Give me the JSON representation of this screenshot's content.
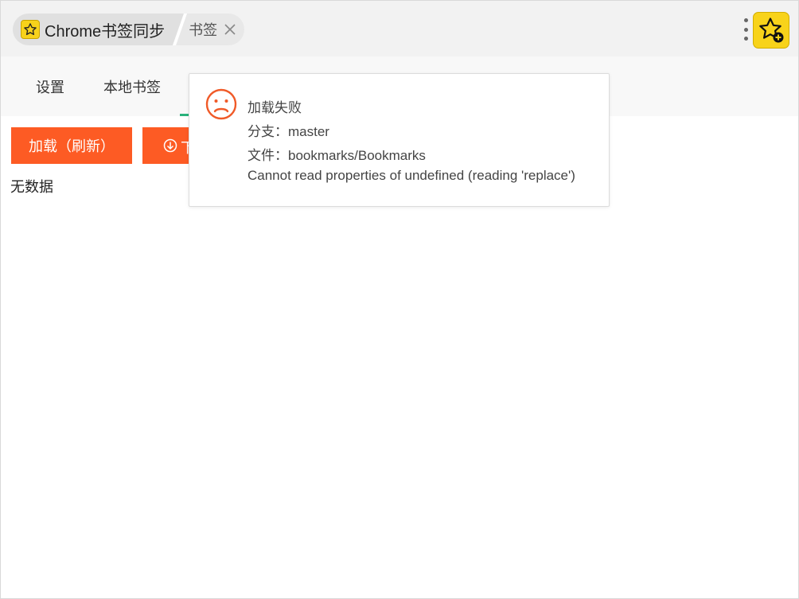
{
  "header": {
    "app_title": "Chrome书签同步",
    "page_label": "书签"
  },
  "tabs": [
    {
      "label": "设置"
    },
    {
      "label": "本地书签"
    }
  ],
  "actions": {
    "load_label": "加载（刷新）",
    "download_label": "下"
  },
  "empty_text": "无数据",
  "error_popup": {
    "title": "加载失败",
    "branch": "分支：master",
    "file": "文件：bookmarks/Bookmarks",
    "message": "Cannot read properties of undefined (reading 'replace')"
  },
  "colors": {
    "accent": "#fd5b24",
    "tab_active": "#2ab27b",
    "logo": "#f7d21b"
  },
  "icons": {
    "logo": "star-icon",
    "close": "close-icon",
    "menu": "kebab-icon",
    "extension": "star-add-icon",
    "download": "download-icon",
    "error": "sad-face-icon"
  }
}
